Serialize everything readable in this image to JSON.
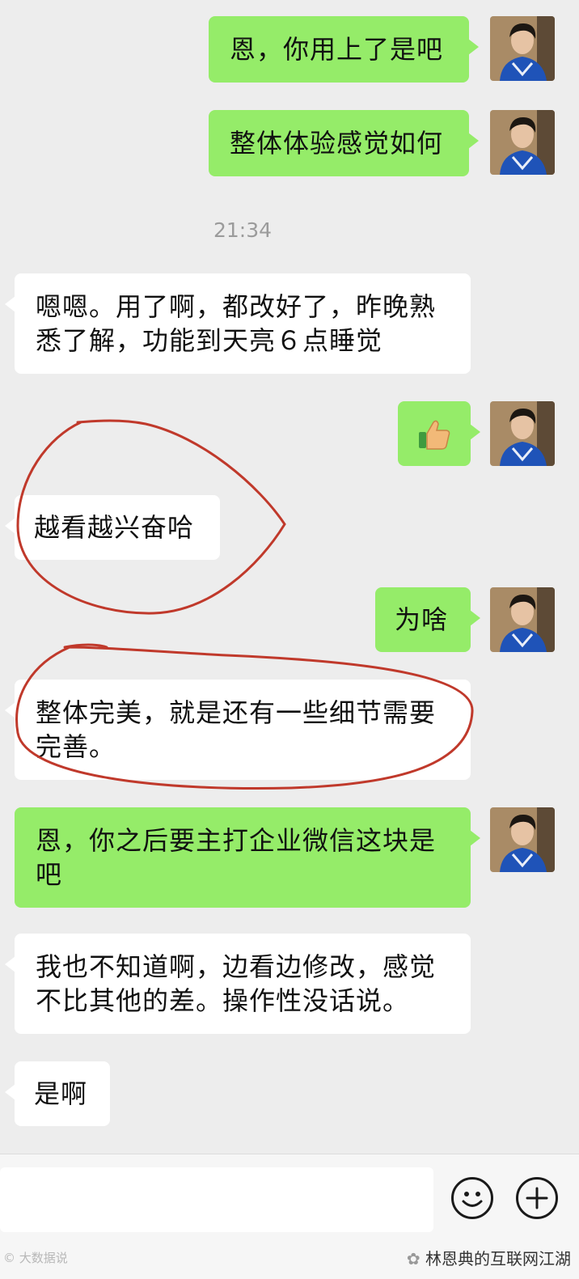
{
  "chat": {
    "messages": [
      {
        "side": "right",
        "text": "恩，你用上了是吧"
      },
      {
        "side": "right",
        "text": "整体体验感觉如何"
      },
      {
        "side": "left",
        "text": "嗯嗯。用了啊，都改好了，昨晚熟悉了解，功能到天亮６点睡觉"
      },
      {
        "side": "right",
        "icon": "thumbs-up-icon"
      },
      {
        "side": "left",
        "text": "越看越兴奋哈"
      },
      {
        "side": "right",
        "text": "为啥"
      },
      {
        "side": "left",
        "text": "整体完美，就是还有一些细节需要完善。"
      },
      {
        "side": "right",
        "text": "恩，你之后要主打企业微信这块是吧"
      },
      {
        "side": "left",
        "text": "我也不知道啊，边看边修改，感觉不比其他的差。操作性没话说。"
      },
      {
        "side": "left",
        "text": "是啊"
      }
    ],
    "timestamp": "21:34"
  },
  "input_bar": {
    "buttons": [
      "emoji-icon",
      "plus-icon"
    ]
  },
  "watermarks": {
    "left": "大数据说",
    "right": "林恩典的互联网江湖"
  },
  "colors": {
    "background": "#ededed",
    "sent_bubble": "#95ec69",
    "received_bubble": "#ffffff",
    "annotation": "#c0392b"
  }
}
